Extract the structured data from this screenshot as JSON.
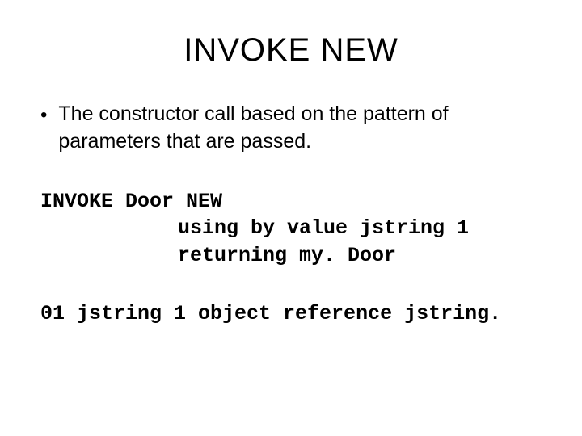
{
  "title": "INVOKE NEW",
  "bullet": {
    "marker": "•",
    "text": "The constructor call based on the pattern of parameters that are passed."
  },
  "code": {
    "line1": "INVOKE Door NEW",
    "line2": "using by value jstring 1",
    "line3": "returning my. Door"
  },
  "declaration": "01 jstring 1 object reference jstring."
}
